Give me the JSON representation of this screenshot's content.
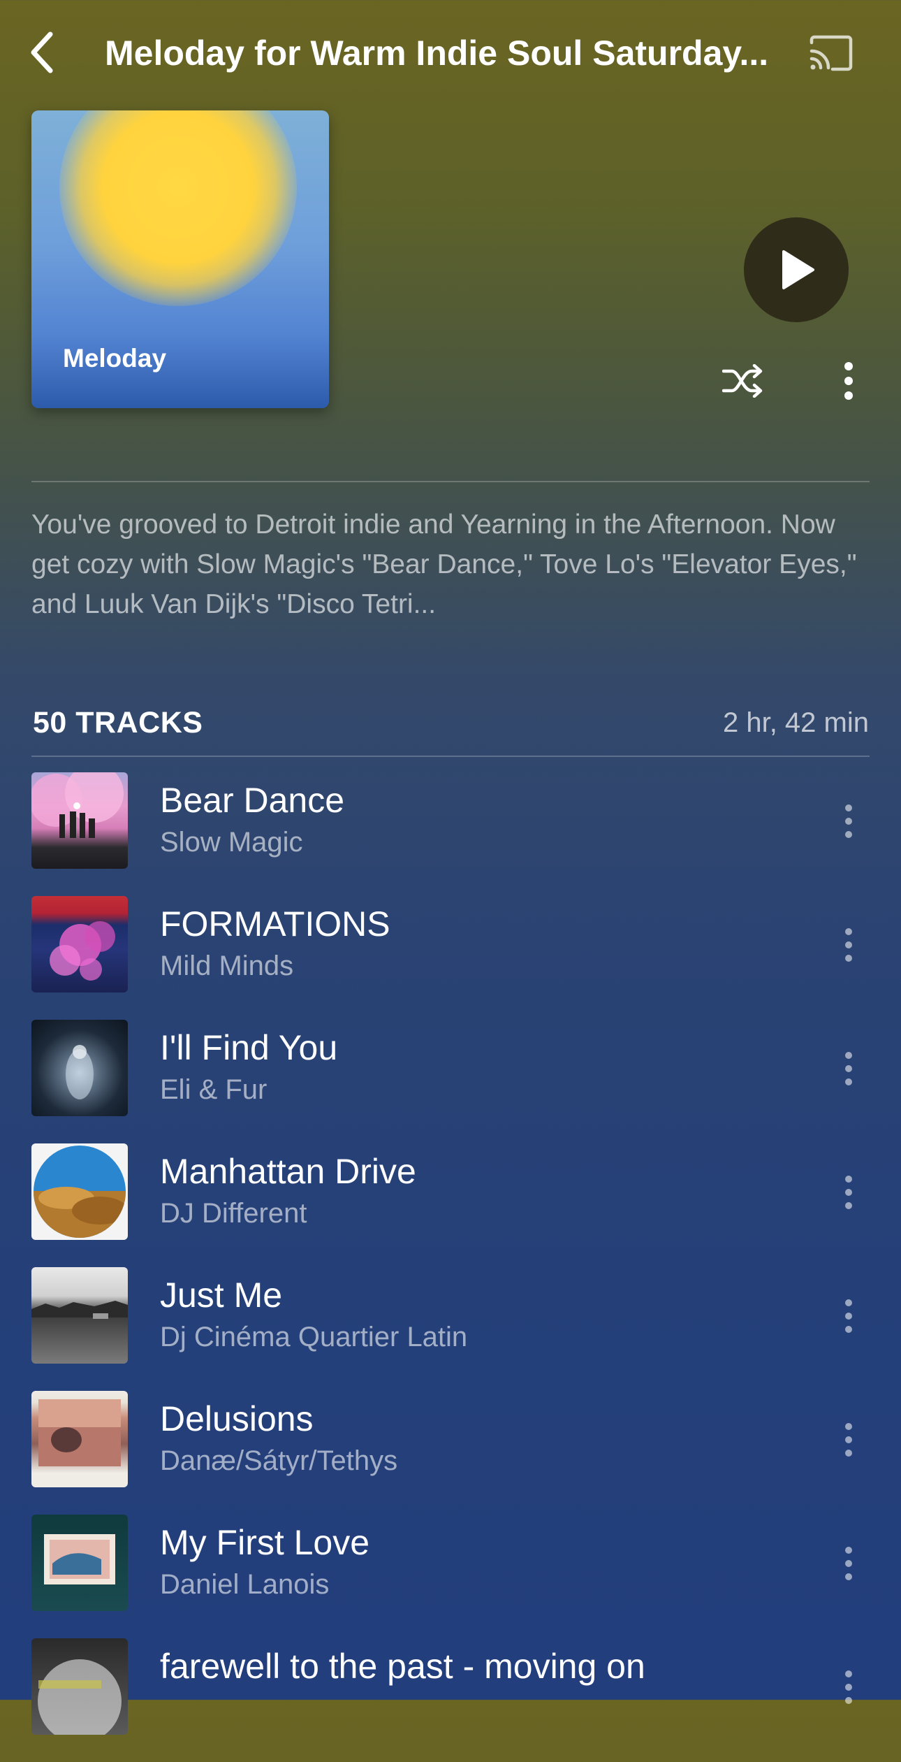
{
  "header": {
    "title": "Meloday for Warm Indie Soul Saturday..."
  },
  "playlist": {
    "cover_label": "Meloday",
    "description": "You've grooved to Detroit indie and Yearning in the Afternoon. Now get cozy with Slow Magic's \"Bear Dance,\" Tove Lo's \"Elevator Eyes,\" and Luuk Van Dijk's \"Disco Tetri...",
    "tracks_count": "50 TRACKS",
    "duration": "2 hr, 42 min"
  },
  "tracks": [
    {
      "title": "Bear Dance",
      "artist": "Slow Magic"
    },
    {
      "title": "FORMATIONS",
      "artist": "Mild Minds"
    },
    {
      "title": "I'll Find You",
      "artist": "Eli & Fur"
    },
    {
      "title": "Manhattan Drive",
      "artist": "DJ Different"
    },
    {
      "title": "Just Me",
      "artist": "Dj Cinéma Quartier Latin"
    },
    {
      "title": "Delusions",
      "artist": "Danæ/Sátyr/Tethys"
    },
    {
      "title": "My First Love",
      "artist": "Daniel Lanois"
    },
    {
      "title": "farewell to the past - moving on",
      "artist": ""
    }
  ],
  "colors": {
    "play_button_bg": "#2f2c1a",
    "text_primary": "#ffffff"
  },
  "icons": {
    "back": "chevron-left-icon",
    "cast": "cast-icon",
    "play": "play-icon",
    "shuffle": "shuffle-icon",
    "more": "more-vertical-icon"
  }
}
